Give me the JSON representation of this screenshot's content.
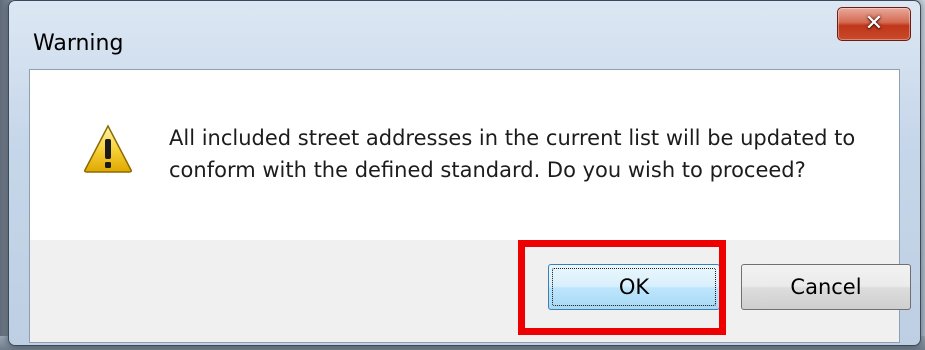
{
  "dialog": {
    "title": "Warning",
    "close_icon": "close-icon",
    "icon": "warning-icon",
    "message_lines": [
      "All included street addresses in the current list will be updated to",
      "conform with the defined standard.  Do you wish to proceed?"
    ],
    "buttons": {
      "ok_label": "OK",
      "cancel_label": "Cancel"
    },
    "default_button": "OK"
  },
  "colors": {
    "highlight": "#ee0000",
    "close_button": "#c94a2c",
    "ok_button_border": "#3c7fb1"
  }
}
